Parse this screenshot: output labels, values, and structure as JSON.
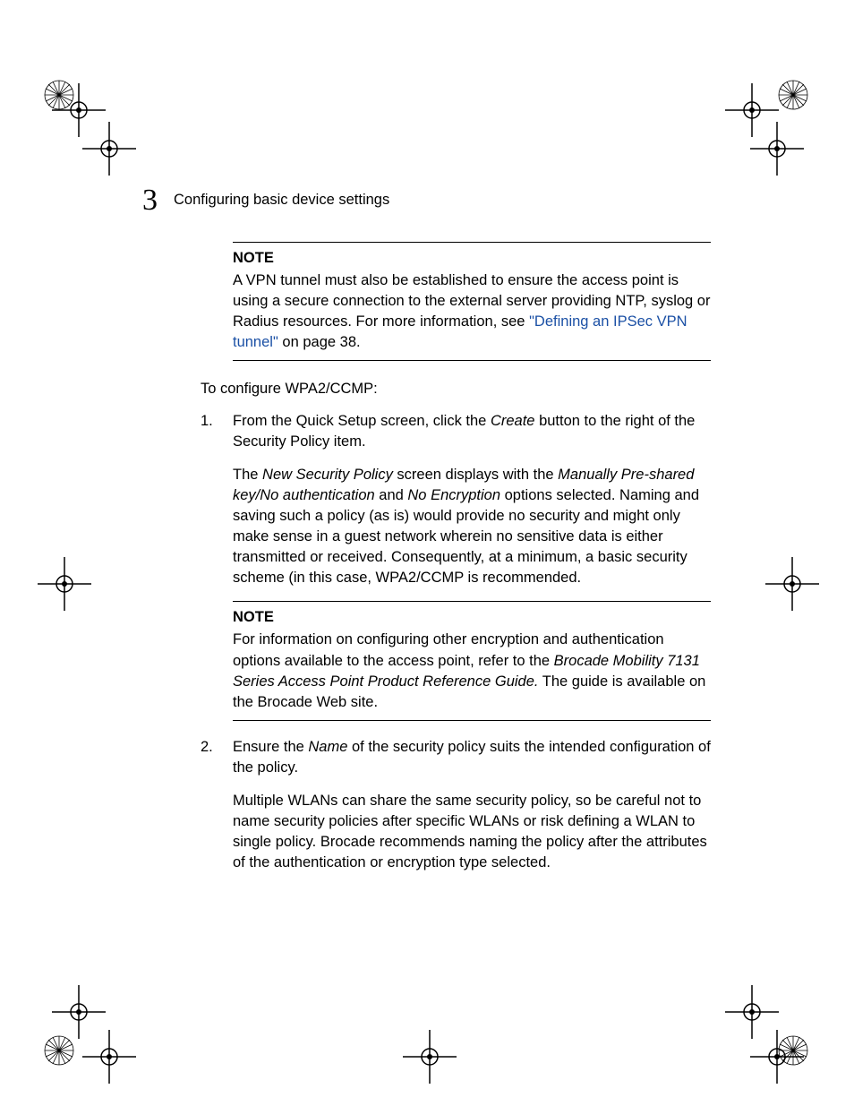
{
  "header": {
    "chapter_number": "3",
    "chapter_title": "Configuring basic device settings"
  },
  "note1": {
    "heading": "NOTE",
    "text_before_link": "A VPN tunnel must also be established to ensure the access point is using a secure connection to the external server providing NTP, syslog or Radius resources. For more information, see ",
    "link_text": "\"Defining an IPSec VPN tunnel\"",
    "text_after_link": " on page 38."
  },
  "lead_text": "To configure WPA2/CCMP:",
  "step1": {
    "number": "1.",
    "p1_a": "From the Quick Setup screen, click the ",
    "p1_ital1": "Create",
    "p1_b": " button to the right of the Security Policy item.",
    "p2_a": "The ",
    "p2_ital1": "New Security Policy",
    "p2_b": " screen displays with the ",
    "p2_ital2": "Manually Pre-shared key/No authentication",
    "p2_c": " and ",
    "p2_ital3": "No Encryption",
    "p2_d": " options selected. Naming and saving such a policy (as is) would provide no security and might only make sense in a guest network wherein no sensitive data is either transmitted or received. Consequently, at a minimum, a basic security scheme (in this case, WPA2/CCMP is recommended."
  },
  "note2": {
    "heading": "NOTE",
    "text_a": "For information on configuring other encryption and authentication options available to the access point, refer to the ",
    "ital": "Brocade Mobility 7131 Series Access Point Product Reference Guide.",
    "text_b": " The guide is available on the Brocade Web site."
  },
  "step2": {
    "number": "2.",
    "p1_a": "Ensure the ",
    "p1_ital1": "Name",
    "p1_b": " of the security policy suits the intended configuration of the policy.",
    "p2": "Multiple WLANs can share the same security policy, so be careful not to name security policies after specific WLANs or risk defining a WLAN to single policy. Brocade recommends naming the policy after the attributes of the authentication or encryption type selected."
  }
}
